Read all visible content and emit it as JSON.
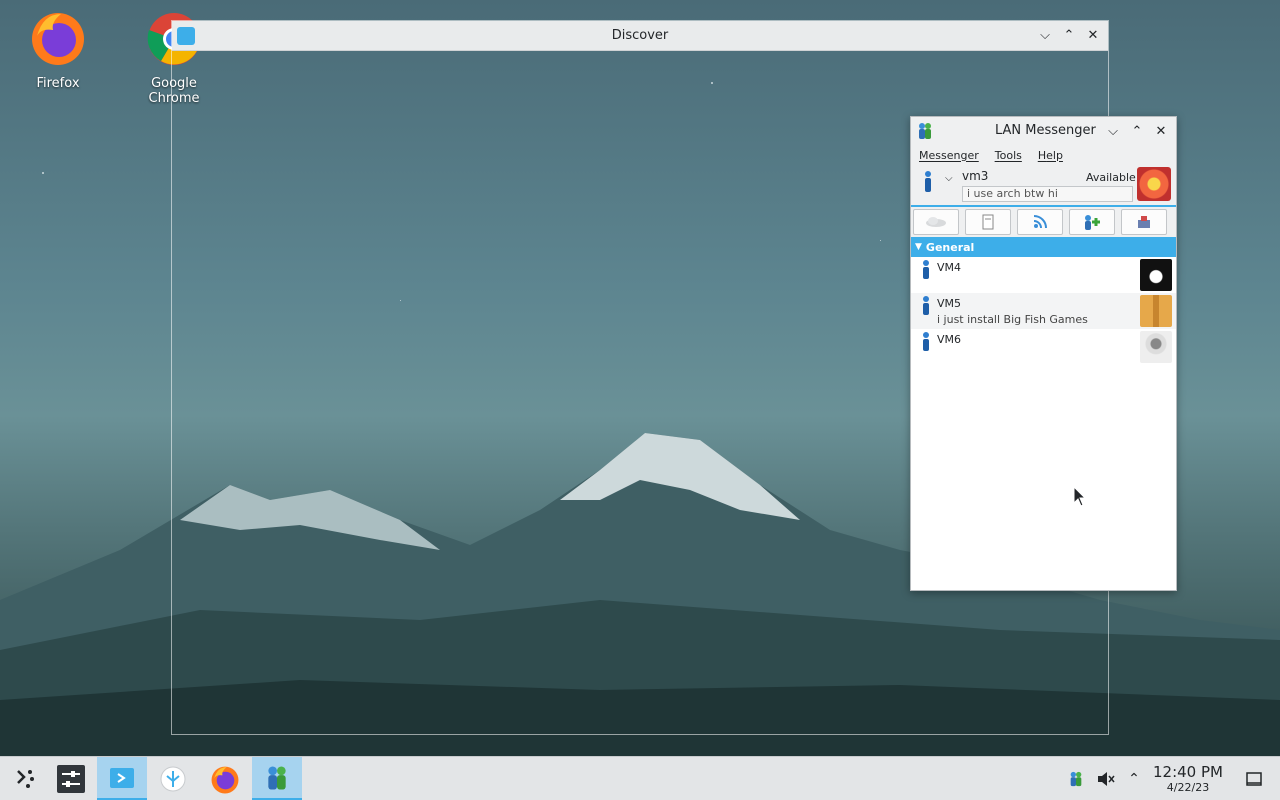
{
  "desktop": {
    "icons": [
      {
        "label": "Firefox"
      },
      {
        "label": "Google Chrome"
      }
    ]
  },
  "discover_window": {
    "title": "Discover"
  },
  "lan_messenger": {
    "title": "LAN Messenger",
    "menu": [
      "Messenger",
      "Tools",
      "Help"
    ],
    "user": {
      "name": "vm3",
      "status": "Available",
      "note": "i use arch btw hi"
    },
    "group": "General",
    "contacts": [
      {
        "name": "VM4",
        "message": ""
      },
      {
        "name": "VM5",
        "message": "i just install Big Fish Games"
      },
      {
        "name": "VM6",
        "message": ""
      }
    ]
  },
  "taskbar": {
    "items": [
      "app-launcher",
      "system-settings",
      "discover",
      "kde-connect",
      "firefox",
      "lan-messenger"
    ],
    "clock": {
      "time": "12:40 PM",
      "date": "4/22/23"
    }
  },
  "colors": {
    "accent": "#3daee9",
    "titlebar": "#e9ebec",
    "taskbar": "#e3e5e7"
  }
}
